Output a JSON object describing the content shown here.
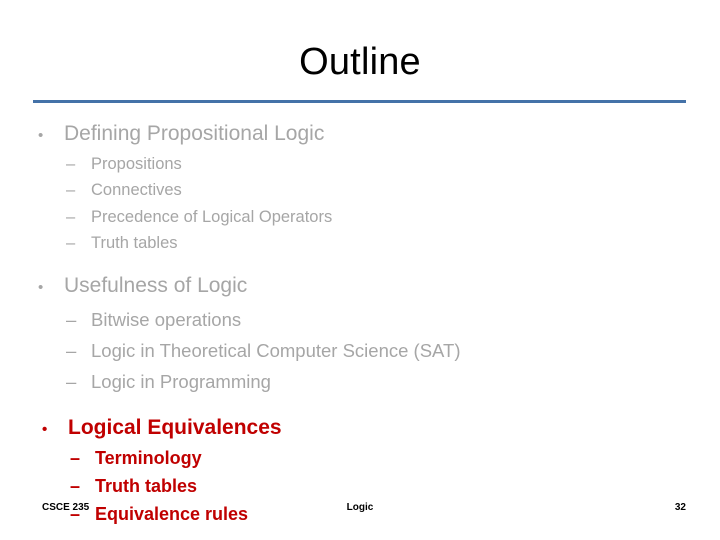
{
  "slide": {
    "title": "Outline",
    "rule_color": "#4472A8",
    "body_text_color": "#A6A6A6",
    "highlight_color": "#C00000",
    "groups": [
      {
        "bullet": "•",
        "heading": "Defining Propositional Logic",
        "sub_marker": "–",
        "items": [
          "Propositions",
          "Connectives",
          "Precedence of Logical Operators",
          "Truth tables"
        ]
      },
      {
        "bullet": "•",
        "heading": "Usefulness of Logic",
        "sub_marker": "–",
        "items": [
          "Bitwise operations",
          "Logic in Theoretical Computer Science (SAT)",
          "Logic in Programming"
        ]
      },
      {
        "bullet": "•",
        "heading": "Logical Equivalences",
        "sub_marker": "–",
        "items": [
          "Terminology",
          "Truth tables",
          "Equivalence rules"
        ]
      }
    ]
  },
  "footer": {
    "course": "CSCE 235",
    "topic": "Logic",
    "page_number": "32"
  }
}
